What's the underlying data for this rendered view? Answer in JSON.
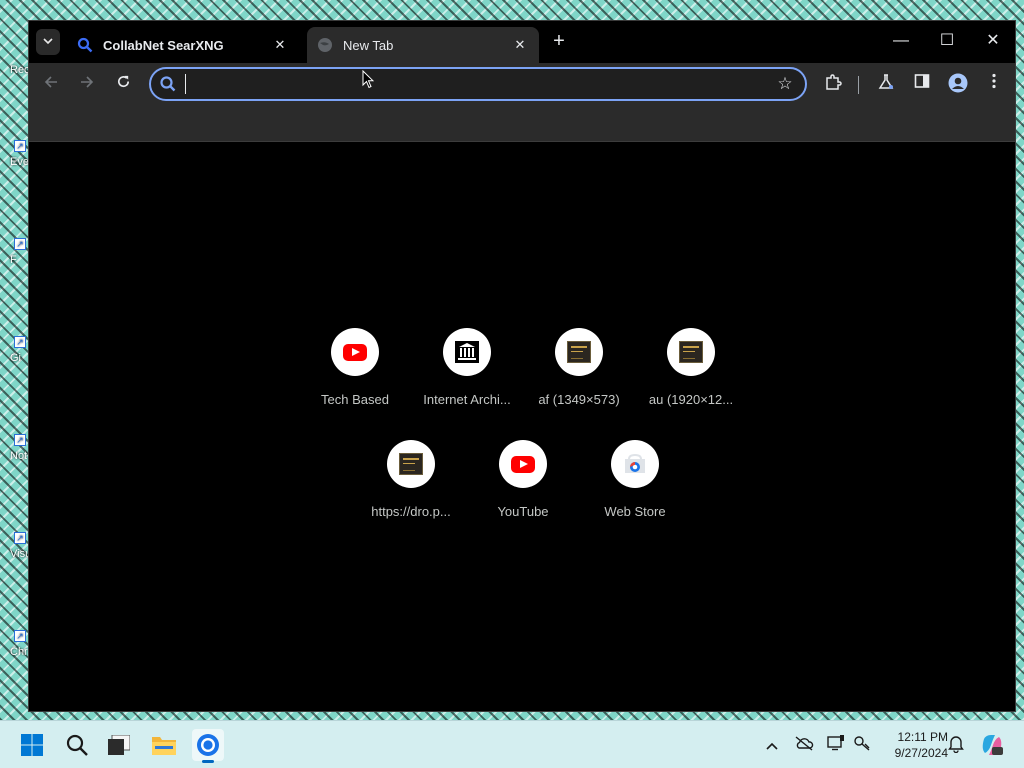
{
  "desktop": {
    "icons": [
      {
        "label": "Rec"
      },
      {
        "label": "Eve"
      },
      {
        "label": "F"
      },
      {
        "label": "Gi"
      },
      {
        "label": "Not"
      },
      {
        "label": "Visu"
      },
      {
        "label": "Chr"
      }
    ]
  },
  "browser": {
    "tabs": [
      {
        "title": "CollabNet SearXNG",
        "active": false,
        "favicon": "search-icon"
      },
      {
        "title": "New Tab",
        "active": true,
        "favicon": "globe-icon"
      }
    ],
    "tab_close": "✕",
    "new_tab": "+",
    "window_controls": {
      "minimize": "—",
      "maximize": "☐",
      "close": "✕"
    },
    "omnibox": {
      "value": "",
      "placeholder": ""
    },
    "shortcuts": [
      {
        "label": "Tech Based",
        "icon": "youtube-icon"
      },
      {
        "label": "Internet Archi...",
        "icon": "archive-icon"
      },
      {
        "label": "af (1349×573)",
        "icon": "thumbnail-icon"
      },
      {
        "label": "au (1920×12...",
        "icon": "thumbnail-icon"
      },
      {
        "label": "https://dro.p...",
        "icon": "thumbnail-icon"
      },
      {
        "label": "YouTube",
        "icon": "youtube-icon"
      },
      {
        "label": "Web Store",
        "icon": "web-store-icon"
      }
    ]
  },
  "taskbar": {
    "time": "12:11 PM",
    "date": "9/27/2024"
  },
  "colors": {
    "accent": "#7ca3f5",
    "toolbar": "#2b2b2b",
    "taskbar": "#d4eef0"
  }
}
